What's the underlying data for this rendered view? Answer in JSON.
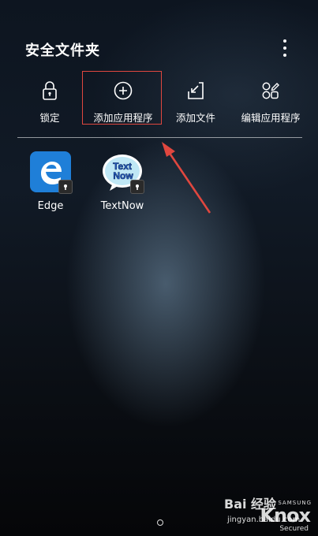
{
  "header": {
    "title": "安全文件夹"
  },
  "actions": [
    {
      "label": "锁定",
      "icon": "lock-icon"
    },
    {
      "label": "添加应用程序",
      "icon": "plus-circle-icon"
    },
    {
      "label": "添加文件",
      "icon": "add-file-icon"
    },
    {
      "label": "编辑应用程序",
      "icon": "edit-apps-icon"
    }
  ],
  "apps": [
    {
      "name": "Edge",
      "icon": "edge-icon"
    },
    {
      "name": "TextNow",
      "icon": "textnow-icon",
      "logo_text": "Text Now"
    }
  ],
  "watermark": {
    "baidu": "Bai 经验",
    "url": "jingyan.baidu.com",
    "brand_small": "SAMSUNG",
    "brand": "Knox",
    "secured": "Secured"
  },
  "colors": {
    "highlight": "#e0473f",
    "edge_blue": "#1f7fd8"
  }
}
